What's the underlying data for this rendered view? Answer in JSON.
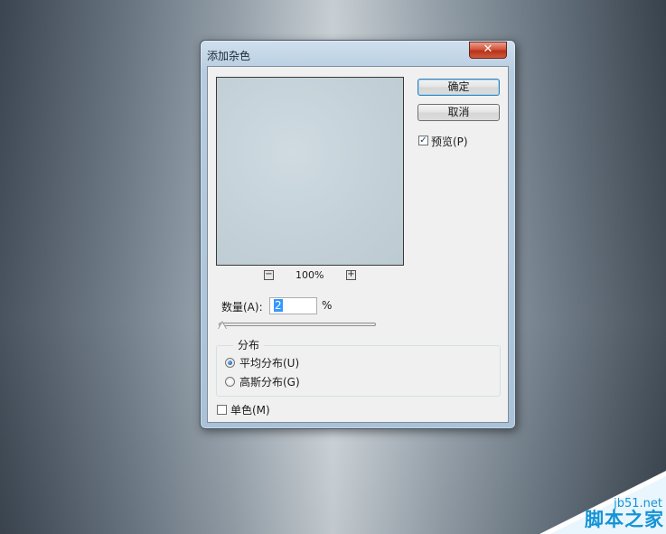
{
  "dialog": {
    "title": "添加杂色",
    "close_symbol": "✕"
  },
  "buttons": {
    "ok_label": "确定",
    "cancel_label": "取消"
  },
  "preview_option": {
    "label": "预览(P)",
    "checked": true
  },
  "zoom": {
    "minus_symbol": "−",
    "level": "100%",
    "plus_symbol": "+"
  },
  "amount": {
    "label": "数量(A):",
    "value": "2",
    "unit": "%",
    "slider_fraction": 0.0
  },
  "distribution": {
    "legend": "分布",
    "options": [
      {
        "label": "平均分布(U)",
        "selected": true
      },
      {
        "label": "高斯分布(G)",
        "selected": false
      }
    ]
  },
  "monochrome": {
    "label": "单色(M)",
    "checked": false
  },
  "watermark": {
    "site": "jb51.net",
    "name": "脚本之家"
  },
  "colors": {
    "accent_blue": "#3399ff",
    "watermark_blue": "#1593d6",
    "close_red": "#c7412a"
  }
}
